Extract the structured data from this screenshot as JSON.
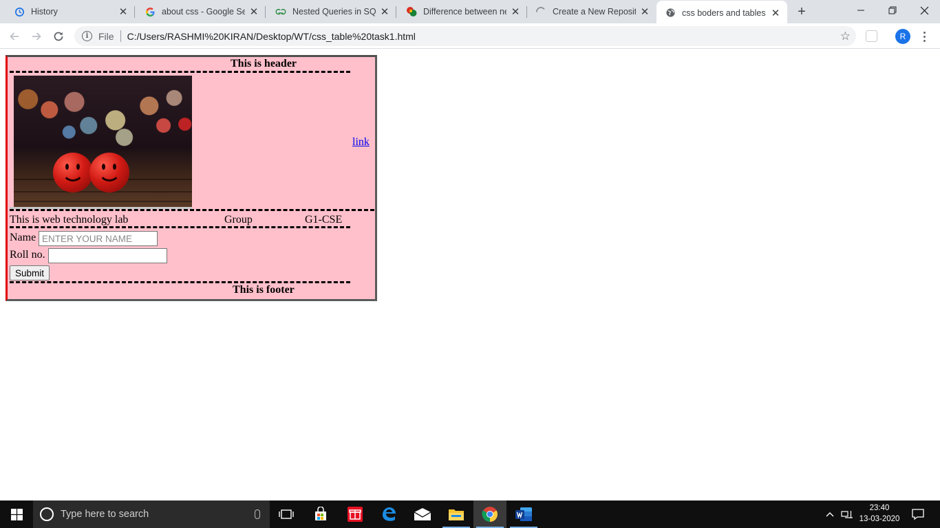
{
  "browser": {
    "tabs": [
      {
        "title": "History",
        "icon": "history-icon"
      },
      {
        "title": "about css - Google Search",
        "icon": "google-icon"
      },
      {
        "title": "Nested Queries in SQL - GeeksforGeeks",
        "icon": "geeksforgeeks-icon"
      },
      {
        "title": "Difference between nested",
        "icon": "site-icon"
      },
      {
        "title": "Create a New Repository",
        "icon": "loading-icon"
      },
      {
        "title": "css boders and tables",
        "icon": "globe-icon"
      }
    ],
    "active_tab": 5,
    "address_scheme": "File",
    "address_url": "C:/Users/RASHMI%20KIRAN/Desktop/WT/css_table%20task1.html",
    "profile_initial": "R"
  },
  "page": {
    "header": "This is header",
    "link": "link",
    "lab_text": "This is web technology lab",
    "group_label": "Group",
    "group_value": "G1-CSE",
    "name_label": "Name",
    "name_placeholder": "ENTER YOUR NAME",
    "name_value": "",
    "roll_label": "Roll no.",
    "roll_value": "",
    "submit_label": "Submit",
    "footer": "This is footer",
    "background_color": "#ffc0cb"
  },
  "taskbar": {
    "search_placeholder": "Type here to search",
    "time": "23:40",
    "date": "13-03-2020",
    "apps": [
      "task-view-icon",
      "store-icon",
      "gift-icon",
      "edge-icon",
      "mail-icon",
      "file-explorer-icon",
      "chrome-icon",
      "word-icon"
    ]
  }
}
